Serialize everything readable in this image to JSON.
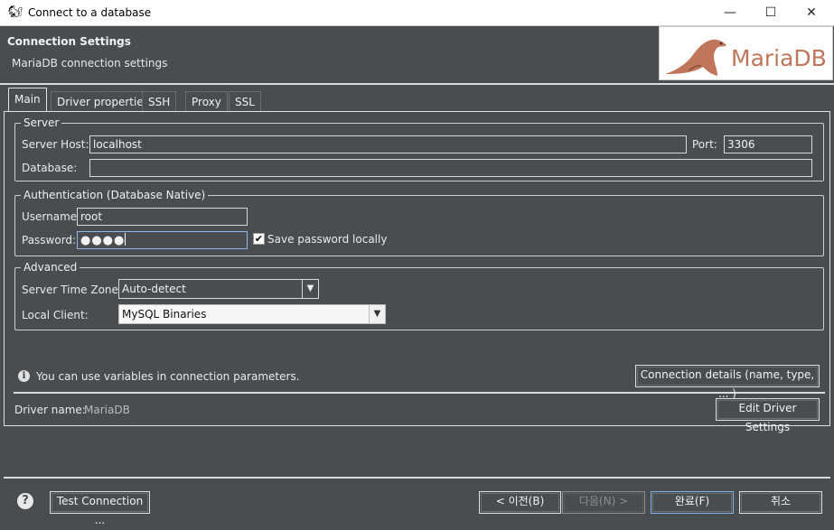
{
  "window": {
    "title": "Connect to a database",
    "controls": {
      "minimize": "—",
      "maximize": "☐",
      "close": "✕"
    }
  },
  "header": {
    "title": "Connection Settings",
    "description": "MariaDB connection settings",
    "logo_text": "MariaDB"
  },
  "tabs": [
    {
      "label": "Main",
      "active": true
    },
    {
      "label": "Driver properties",
      "active": false
    },
    {
      "label": "SSH",
      "active": false
    },
    {
      "label": "Proxy",
      "active": false
    },
    {
      "label": "SSL",
      "active": false
    }
  ],
  "server": {
    "legend": "Server",
    "host_label": "Server Host:",
    "host_value": "localhost",
    "port_label": "Port:",
    "port_value": "3306",
    "database_label": "Database:",
    "database_value": ""
  },
  "auth": {
    "legend": "Authentication (Database Native)",
    "username_label": "Username:",
    "username_value": "root",
    "password_label": "Password:",
    "password_value": "●●●●",
    "save_password_label": "Save password locally",
    "save_password_checked": true
  },
  "advanced": {
    "legend": "Advanced",
    "timezone_label": "Server Time Zone:",
    "timezone_value": "Auto-detect",
    "local_client_label": "Local Client:",
    "local_client_value": "MySQL Binaries"
  },
  "info": {
    "text": "You can use variables in connection parameters.",
    "connection_details_button": "Connection details (name, type, ... )"
  },
  "driver": {
    "label": "Driver name:",
    "value": "MariaDB",
    "edit_button": "Edit Driver Settings"
  },
  "footer": {
    "test_connection": "Test Connection ...",
    "back": "< 이전(B)",
    "next": "다음(N) >",
    "finish": "완료(F)",
    "cancel": "취소"
  },
  "colors": {
    "background": "#4a4d50",
    "logo_brand": "#c0765a",
    "focus_border": "#8fb6e6"
  }
}
